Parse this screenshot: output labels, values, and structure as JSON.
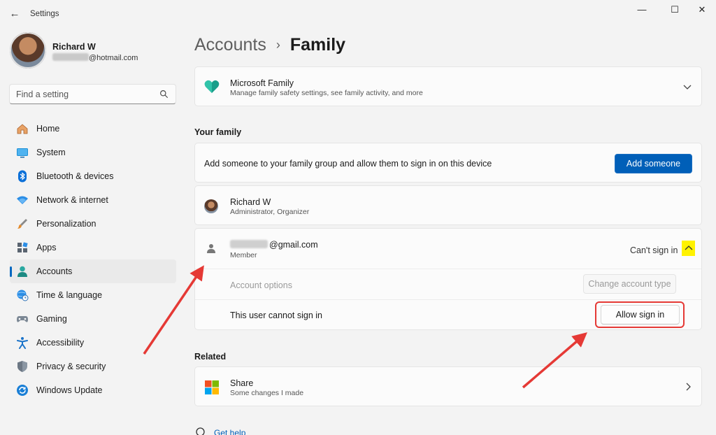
{
  "window": {
    "title": "Settings",
    "controls": {
      "minimize": "—",
      "maximize": "☐",
      "close": "✕"
    }
  },
  "user": {
    "name": "Richard W",
    "email_suffix": "@hotmail.com"
  },
  "search": {
    "placeholder": "Find a setting"
  },
  "sidebar": {
    "items": [
      {
        "label": "Home",
        "icon": "home-icon"
      },
      {
        "label": "System",
        "icon": "system-icon"
      },
      {
        "label": "Bluetooth & devices",
        "icon": "bluetooth-icon"
      },
      {
        "label": "Network & internet",
        "icon": "wifi-icon"
      },
      {
        "label": "Personalization",
        "icon": "brush-icon"
      },
      {
        "label": "Apps",
        "icon": "apps-icon"
      },
      {
        "label": "Accounts",
        "icon": "person-icon",
        "active": true
      },
      {
        "label": "Time & language",
        "icon": "globe-clock-icon"
      },
      {
        "label": "Gaming",
        "icon": "gamepad-icon"
      },
      {
        "label": "Accessibility",
        "icon": "accessibility-icon"
      },
      {
        "label": "Privacy & security",
        "icon": "shield-icon"
      },
      {
        "label": "Windows Update",
        "icon": "update-icon"
      }
    ]
  },
  "breadcrumb": {
    "parent": "Accounts",
    "separator": "›",
    "current": "Family"
  },
  "microsoft_family": {
    "title": "Microsoft Family",
    "subtitle": "Manage family safety settings, see family activity, and more"
  },
  "your_family": {
    "heading": "Your family",
    "add_text": "Add someone to your family group and allow them to sign in on this device",
    "add_button": "Add someone",
    "members": [
      {
        "name": "Richard W",
        "role": "Administrator, Organizer"
      },
      {
        "email_suffix": "@gmail.com",
        "role": "Member",
        "status": "Can't sign in",
        "account_options_label": "Account options",
        "change_type_button": "Change account type",
        "cannot_sign_in_text": "This user cannot sign in",
        "allow_sign_in_button": "Allow sign in"
      }
    ]
  },
  "related": {
    "heading": "Related",
    "share_title": "Share",
    "share_subtitle": "Some changes I made"
  },
  "get_help": "Get help",
  "colors": {
    "accent": "#005fb8",
    "annotation": "#e53935",
    "highlight": "#fff200"
  }
}
